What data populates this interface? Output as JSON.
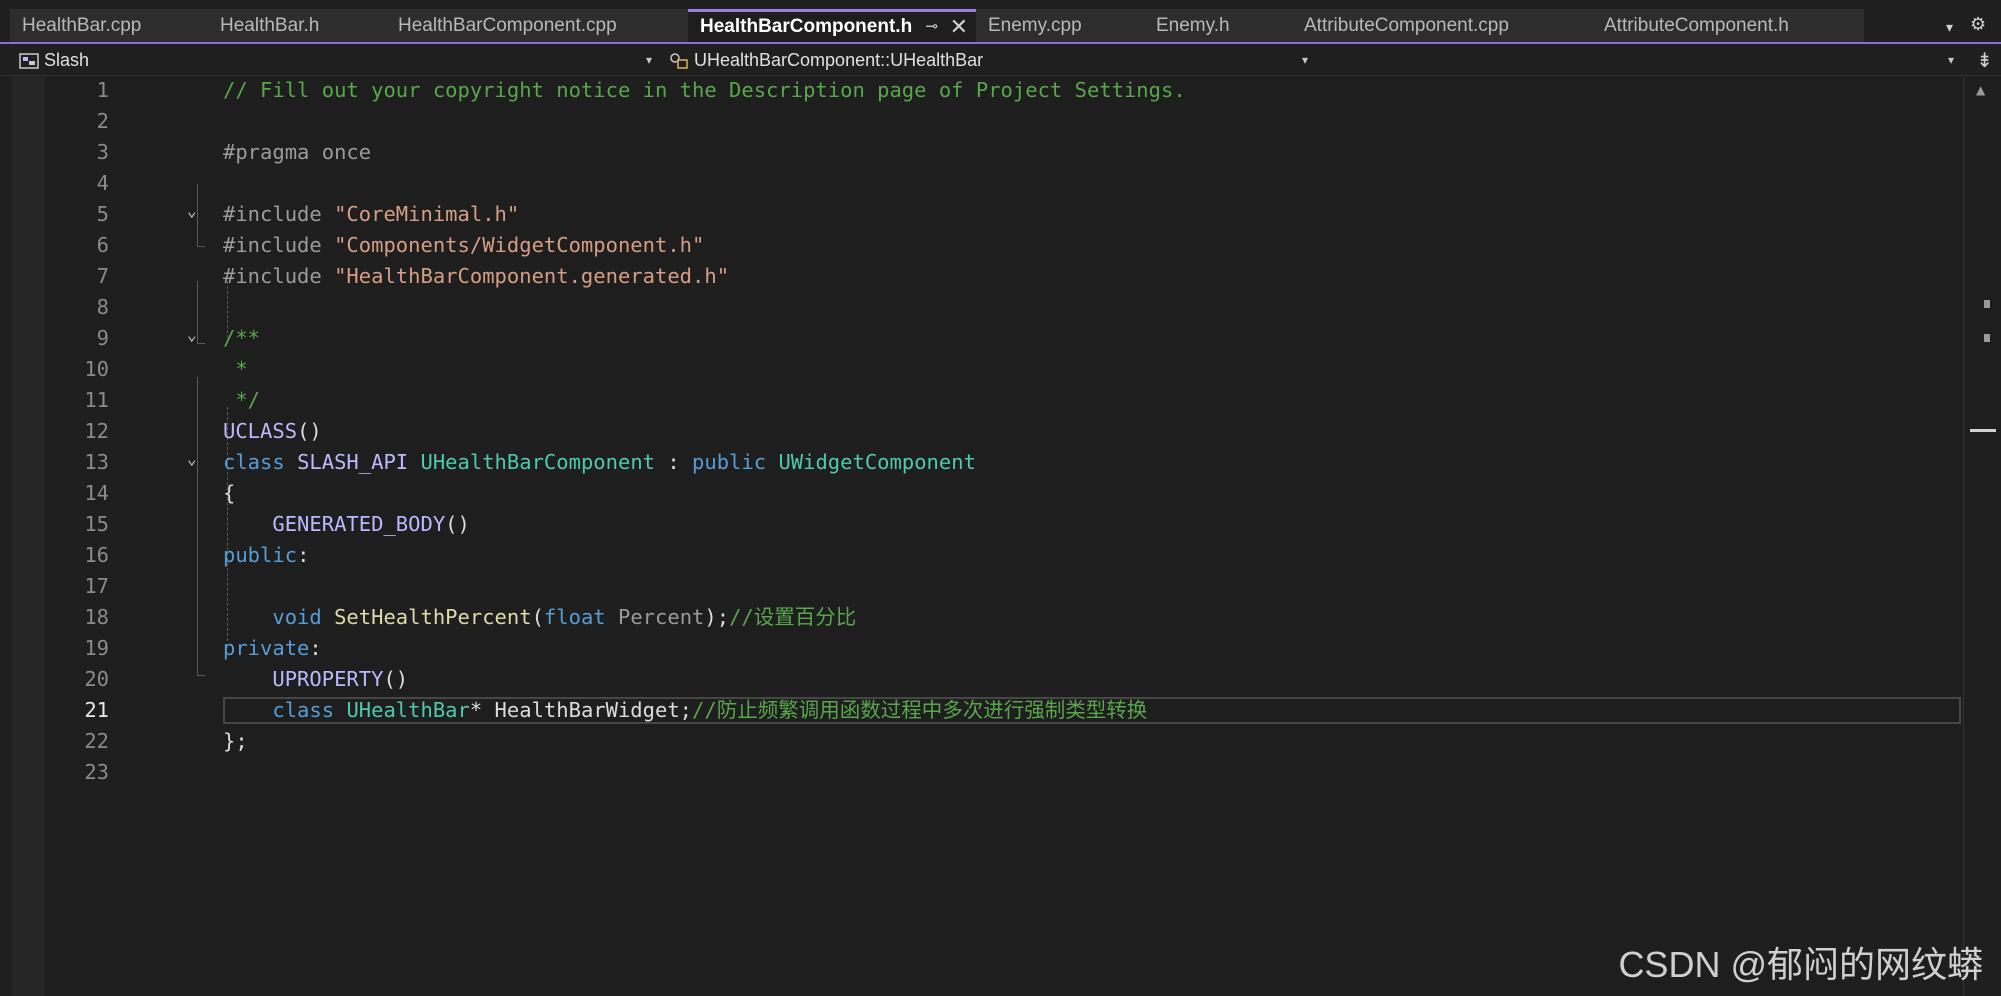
{
  "tabs": [
    {
      "label": "HealthBar.cpp",
      "active": false
    },
    {
      "label": "HealthBar.h",
      "active": false
    },
    {
      "label": "HealthBarComponent.cpp",
      "active": false
    },
    {
      "label": "HealthBarComponent.h",
      "active": true
    },
    {
      "label": "Enemy.cpp",
      "active": false
    },
    {
      "label": "Enemy.h",
      "active": false
    },
    {
      "label": "AttributeComponent.cpp",
      "active": false
    },
    {
      "label": "AttributeComponent.h",
      "active": false
    }
  ],
  "navbar": {
    "project": "Slash",
    "scope": "UHealthBarComponent::UHealthBar",
    "member": ""
  },
  "editor": {
    "current_line": 21,
    "lines": [
      {
        "n": "1",
        "tokens": [
          [
            "cm",
            "// Fill out your copyright notice in the Description page of Project Settings."
          ]
        ]
      },
      {
        "n": "2",
        "tokens": []
      },
      {
        "n": "3",
        "tokens": [
          [
            "pp",
            "#pragma once"
          ]
        ]
      },
      {
        "n": "4",
        "tokens": []
      },
      {
        "n": "5",
        "fold": true,
        "tokens": [
          [
            "pp",
            "#include "
          ],
          [
            "str",
            "\"CoreMinimal.h\""
          ]
        ]
      },
      {
        "n": "6",
        "tokens": [
          [
            "pp",
            "#include "
          ],
          [
            "str",
            "\"Components/WidgetComponent.h\""
          ]
        ]
      },
      {
        "n": "7",
        "tokens": [
          [
            "pp",
            "#include "
          ],
          [
            "str",
            "\"HealthBarComponent.generated.h\""
          ]
        ]
      },
      {
        "n": "8",
        "tokens": []
      },
      {
        "n": "9",
        "fold": true,
        "tokens": [
          [
            "cm",
            "/**"
          ]
        ]
      },
      {
        "n": "10",
        "tokens": [
          [
            "cm",
            " *"
          ]
        ]
      },
      {
        "n": "11",
        "tokens": [
          [
            "cm",
            " */"
          ]
        ]
      },
      {
        "n": "12",
        "tokens": [
          [
            "mac",
            "UCLASS"
          ],
          [
            "pl",
            "()"
          ]
        ]
      },
      {
        "n": "13",
        "fold": true,
        "tokens": [
          [
            "kw",
            "class "
          ],
          [
            "mac",
            "SLASH_API"
          ],
          [
            "pl",
            " "
          ],
          [
            "ty",
            "UHealthBarComponent"
          ],
          [
            "pl",
            " : "
          ],
          [
            "kw",
            "public "
          ],
          [
            "ty",
            "UWidgetComponent"
          ]
        ]
      },
      {
        "n": "14",
        "tokens": [
          [
            "pl",
            "{"
          ]
        ]
      },
      {
        "n": "15",
        "tokens": [
          [
            "pl",
            "    "
          ],
          [
            "mac",
            "GENERATED_BODY"
          ],
          [
            "pl",
            "()"
          ]
        ]
      },
      {
        "n": "16",
        "tokens": [
          [
            "kw",
            "public"
          ],
          [
            "pl",
            ":"
          ]
        ]
      },
      {
        "n": "17",
        "tokens": []
      },
      {
        "n": "18",
        "tokens": [
          [
            "pl",
            "    "
          ],
          [
            "kw",
            "void "
          ],
          [
            "fn",
            "SetHealthPercent"
          ],
          [
            "pl",
            "("
          ],
          [
            "kw",
            "float "
          ],
          [
            "par",
            "Percent"
          ],
          [
            "pl",
            ");"
          ],
          [
            "cm",
            "//设置百分比"
          ]
        ]
      },
      {
        "n": "19",
        "tokens": [
          [
            "kw",
            "private"
          ],
          [
            "pl",
            ":"
          ]
        ]
      },
      {
        "n": "20",
        "tokens": [
          [
            "pl",
            "    "
          ],
          [
            "mac",
            "UPROPERTY"
          ],
          [
            "pl",
            "()"
          ]
        ]
      },
      {
        "n": "21",
        "tokens": [
          [
            "pl",
            "    "
          ],
          [
            "kw",
            "class "
          ],
          [
            "ty",
            "UHealthBar"
          ],
          [
            "pl",
            "* HealthBarWidget;"
          ],
          [
            "cm",
            "//防止频繁调用函数过程中多次进行强制类型转换"
          ]
        ]
      },
      {
        "n": "22",
        "tokens": [
          [
            "pl",
            "};"
          ]
        ]
      },
      {
        "n": "23",
        "tokens": []
      }
    ]
  },
  "watermark": "CSDN @郁闷的网纹蟒",
  "colors": {
    "accent": "#8a6fd6",
    "comment": "#57a64a",
    "keyword": "#569cd6",
    "string": "#d69d85",
    "type": "#4ec9b0",
    "function": "#dcdcaa",
    "macro": "#beb7ff"
  }
}
